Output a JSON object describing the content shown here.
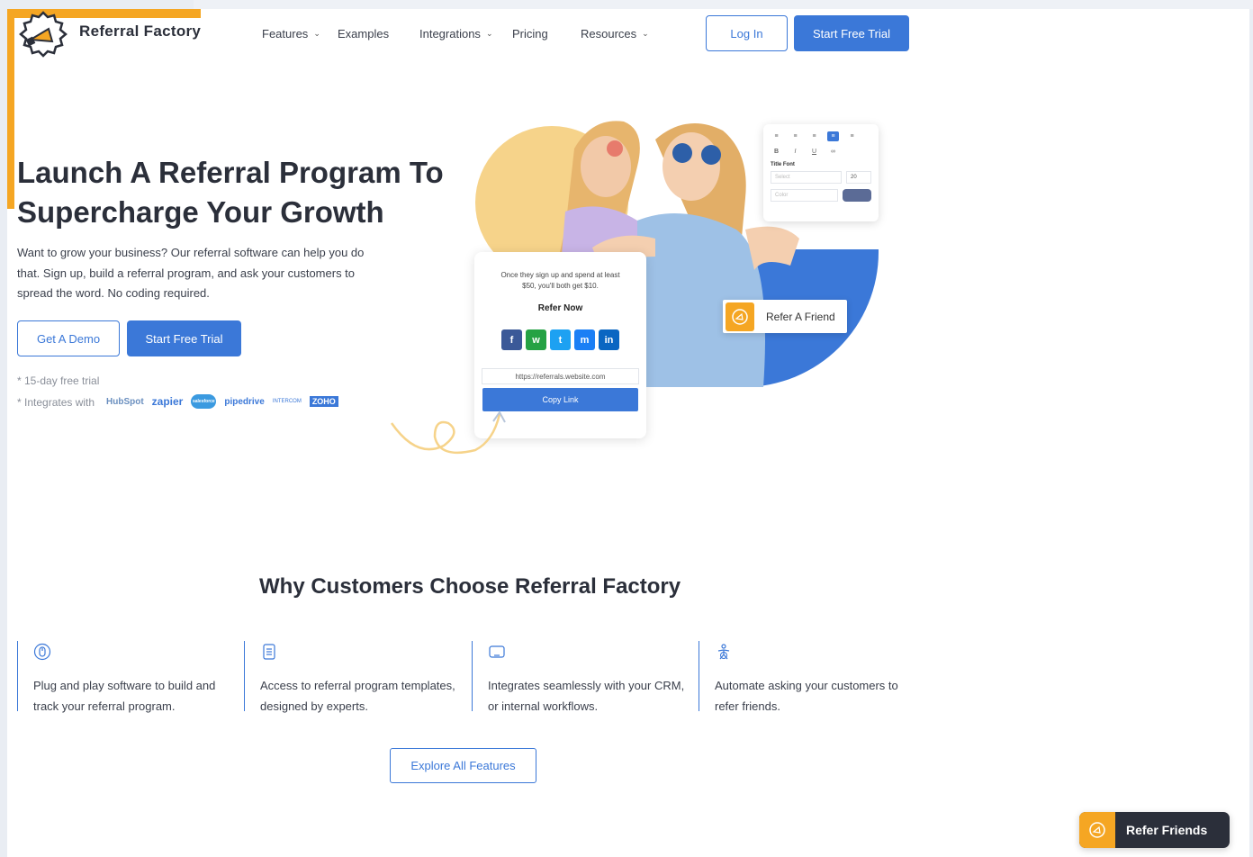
{
  "brand": {
    "name": "Referral Factory"
  },
  "nav": {
    "items": [
      {
        "label": "Features",
        "dropdown": true
      },
      {
        "label": "Examples",
        "dropdown": false
      },
      {
        "label": "Integrations",
        "dropdown": true
      },
      {
        "label": "Pricing",
        "dropdown": false
      },
      {
        "label": "Resources",
        "dropdown": true
      }
    ],
    "login_label": "Log In",
    "trial_label": "Start Free Trial"
  },
  "hero": {
    "title_line1": "Launch A Referral Program To",
    "title_line2": "Supercharge Your Growth",
    "subtitle": "Want to grow your business? Our referral software can help you do that. Sign up, build a referral program, and ask your customers to spread the word. No coding required.",
    "demo_label": "Get A Demo",
    "trial_label": "Start Free Trial",
    "trial_note": "* 15-day free trial",
    "integrates_note": "* Integrates with",
    "integrations": [
      "HubSpot",
      "zapier",
      "salesforce",
      "pipedrive",
      "INTERCOM",
      "ZOHO"
    ]
  },
  "illustration": {
    "editor": {
      "title_font_label": "Title Font",
      "select_placeholder": "Select",
      "size_value": "20",
      "color_placeholder": "Color"
    },
    "widget": {
      "text": "Once they sign up and spend at least $50, you'll both get $10.",
      "title": "Refer Now",
      "link": "https://referrals.website.com",
      "copy_label": "Copy Link",
      "socials": [
        {
          "icon": "f",
          "color": "#3b5998"
        },
        {
          "icon": "w",
          "color": "#25a244"
        },
        {
          "icon": "t",
          "color": "#1da1f2"
        },
        {
          "icon": "m",
          "color": "#1b7ff5"
        },
        {
          "icon": "in",
          "color": "#0a66c2"
        }
      ]
    },
    "refer_friend_label": "Refer A Friend"
  },
  "why": {
    "title": "Why Customers Choose Referral Factory",
    "features": [
      {
        "icon": "mouse-icon",
        "text": "Plug and play software to build and track your referral program."
      },
      {
        "icon": "template-icon",
        "text": "Access to referral program templates, designed by experts."
      },
      {
        "icon": "monitor-icon",
        "text": "Integrates seamlessly with your CRM, or internal workflows."
      },
      {
        "icon": "automation-icon",
        "text": "Automate asking your customers to refer friends."
      }
    ],
    "explore_label": "Explore All Features"
  },
  "floating": {
    "refer_friends_label": "Refer Friends"
  },
  "colors": {
    "accent": "#3b78d8",
    "orange": "#f5a623",
    "dark": "#2b2f3a"
  }
}
